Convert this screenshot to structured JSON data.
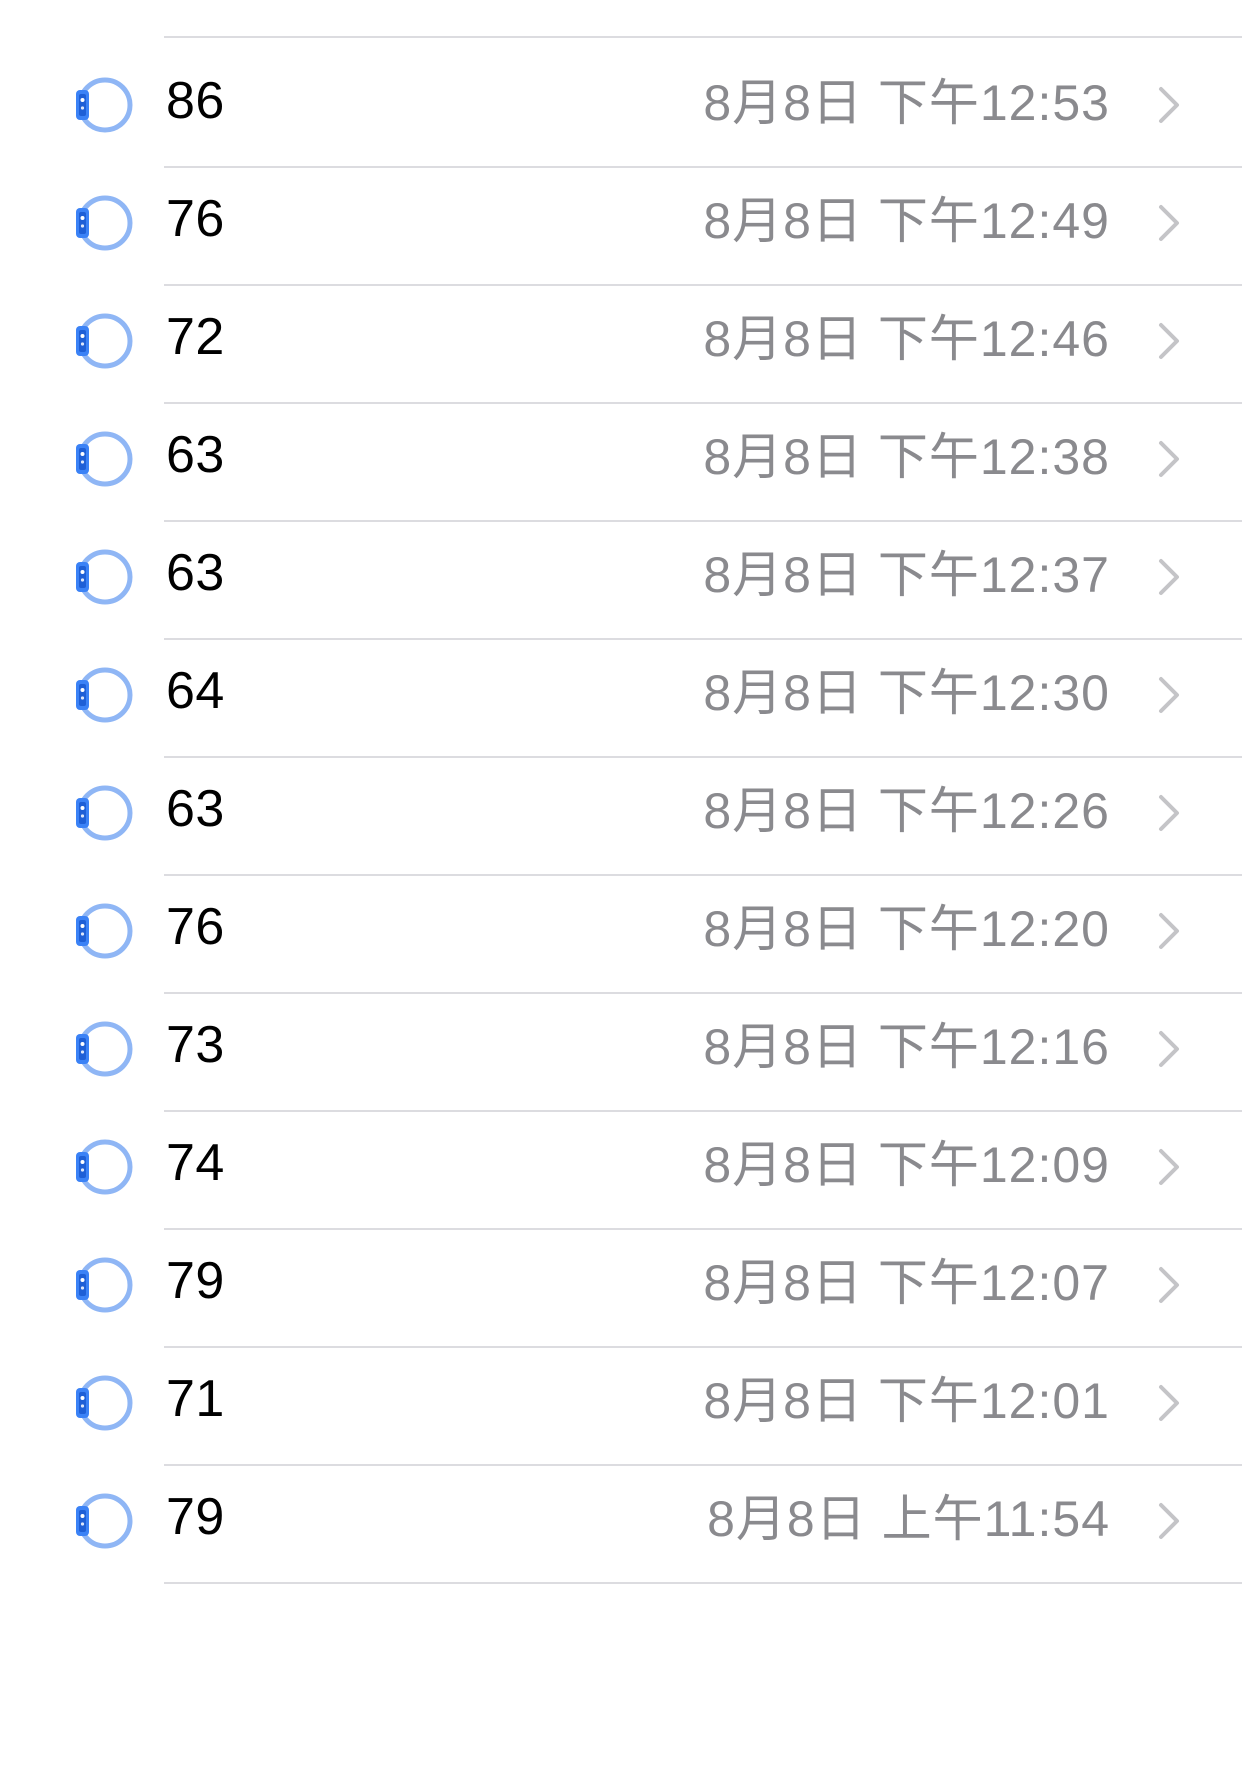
{
  "colors": {
    "accent": "#3b82f6",
    "text_primary": "#000000",
    "text_secondary": "#8a8a8e",
    "divider": "#dcdce0"
  },
  "rows": [
    {
      "value": "86",
      "timestamp": "8月8日 下午12:53",
      "icon": "watch-icon"
    },
    {
      "value": "76",
      "timestamp": "8月8日 下午12:49",
      "icon": "watch-icon"
    },
    {
      "value": "72",
      "timestamp": "8月8日 下午12:46",
      "icon": "watch-icon"
    },
    {
      "value": "63",
      "timestamp": "8月8日 下午12:38",
      "icon": "watch-icon"
    },
    {
      "value": "63",
      "timestamp": "8月8日 下午12:37",
      "icon": "watch-icon"
    },
    {
      "value": "64",
      "timestamp": "8月8日 下午12:30",
      "icon": "watch-icon"
    },
    {
      "value": "63",
      "timestamp": "8月8日 下午12:26",
      "icon": "watch-icon"
    },
    {
      "value": "76",
      "timestamp": "8月8日 下午12:20",
      "icon": "watch-icon"
    },
    {
      "value": "73",
      "timestamp": "8月8日 下午12:16",
      "icon": "watch-icon"
    },
    {
      "value": "74",
      "timestamp": "8月8日 下午12:09",
      "icon": "watch-icon"
    },
    {
      "value": "79",
      "timestamp": "8月8日 下午12:07",
      "icon": "watch-icon"
    },
    {
      "value": "71",
      "timestamp": "8月8日 下午12:01",
      "icon": "watch-icon"
    },
    {
      "value": "79",
      "timestamp": "8月8日 上午11:54",
      "icon": "watch-icon"
    }
  ]
}
